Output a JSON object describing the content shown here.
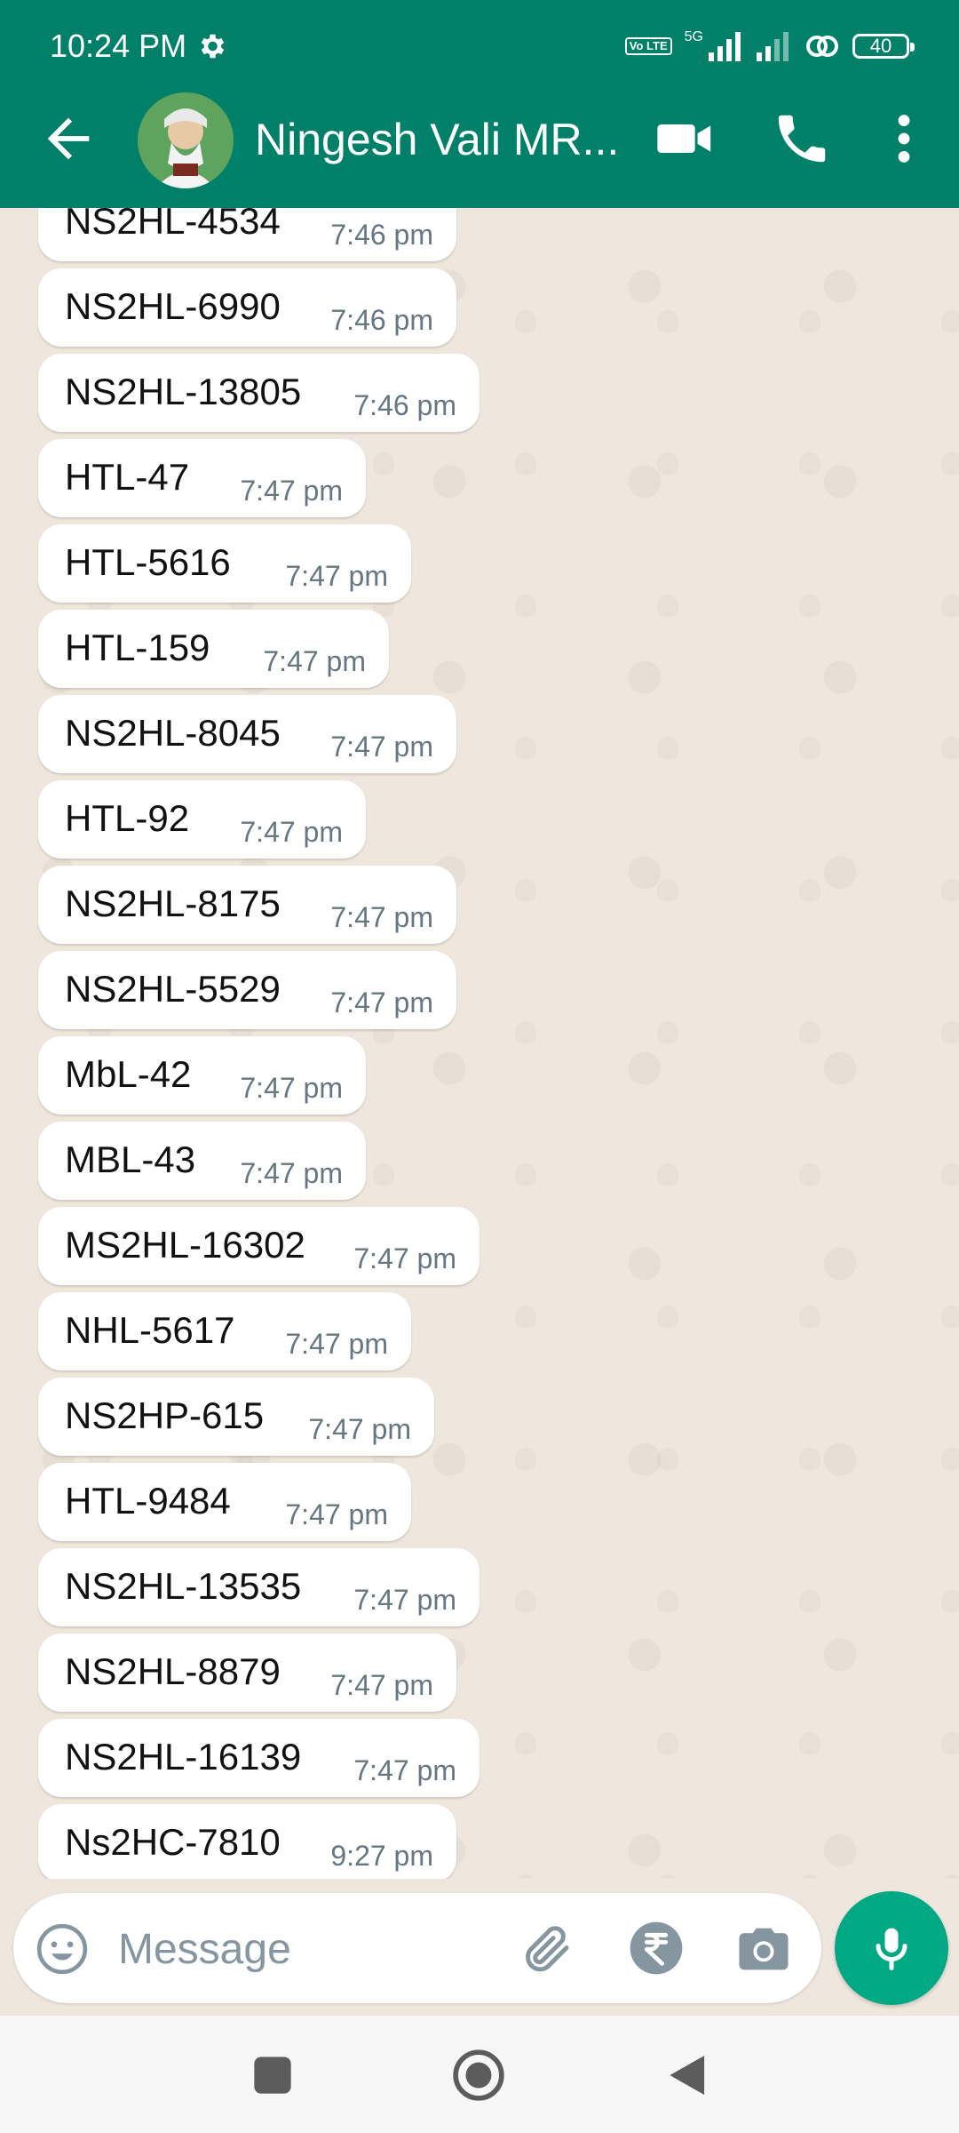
{
  "status_bar": {
    "time": "10:24 PM",
    "network": "5G",
    "volte": "Vo LTE",
    "battery": "40"
  },
  "header": {
    "contact_name": "Ningesh Vali MR..."
  },
  "messages": [
    {
      "text": "NS2HL-4534",
      "time": "7:46 pm"
    },
    {
      "text": "NS2HL-6990",
      "time": "7:46 pm"
    },
    {
      "text": "NS2HL-13805",
      "time": "7:46 pm"
    },
    {
      "text": "HTL-47",
      "time": "7:47 pm"
    },
    {
      "text": "HTL-5616",
      "time": "7:47 pm"
    },
    {
      "text": "HTL-159",
      "time": "7:47 pm"
    },
    {
      "text": "NS2HL-8045",
      "time": "7:47 pm"
    },
    {
      "text": "HTL-92",
      "time": "7:47 pm"
    },
    {
      "text": "NS2HL-8175",
      "time": "7:47 pm"
    },
    {
      "text": "NS2HL-5529",
      "time": "7:47 pm"
    },
    {
      "text": "MbL-42",
      "time": "7:47 pm"
    },
    {
      "text": "MBL-43",
      "time": "7:47 pm"
    },
    {
      "text": "MS2HL-16302",
      "time": "7:47 pm"
    },
    {
      "text": "NHL-5617",
      "time": "7:47 pm"
    },
    {
      "text": "NS2HP-615",
      "time": "7:47 pm"
    },
    {
      "text": "HTL-9484",
      "time": "7:47 pm"
    },
    {
      "text": "NS2HL-13535",
      "time": "7:47 pm"
    },
    {
      "text": "NS2HL-8879",
      "time": "7:47 pm"
    },
    {
      "text": "NS2HL-16139",
      "time": "7:47 pm"
    },
    {
      "text": "Ns2HC-7810",
      "time": "9:27 pm"
    }
  ],
  "composer": {
    "placeholder": "Message"
  },
  "icons": {
    "back": "arrow-left-icon",
    "video": "video-camera-icon",
    "call": "phone-icon",
    "menu": "more-vertical-icon",
    "emoji": "emoji-icon",
    "attach": "paperclip-icon",
    "payment": "rupee-icon",
    "camera": "camera-icon",
    "mic": "microphone-icon"
  },
  "colors": {
    "header": "#008069",
    "accent": "#00a884",
    "chat_bg": "#efe7dd",
    "bubble": "#ffffff",
    "timestamp": "#667781"
  }
}
